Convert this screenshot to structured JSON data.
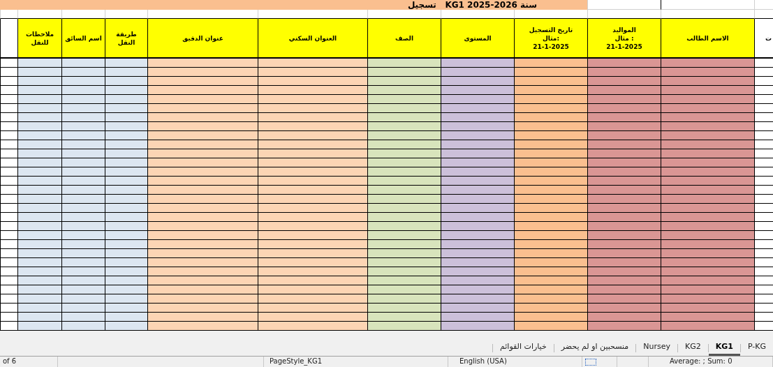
{
  "sheet": {
    "title": "سنة KG1 2025-2026   تسجيل",
    "columns": [
      {
        "header": "ت",
        "color": "#ffffff"
      },
      {
        "header": "الاسم الطالب",
        "color": "#da9694"
      },
      {
        "header": "المواليد\n: مثال\n21-1-2025",
        "color": "#da9694"
      },
      {
        "header": "تاريخ التسجيل\n:مثال\n21-1-2025",
        "color": "#fabf8f"
      },
      {
        "header": "المستوى",
        "color": "#ccc0da"
      },
      {
        "header": "الصف",
        "color": "#d8e4bc"
      },
      {
        "header": "العنوان السكني",
        "color": "#fcd5b4"
      },
      {
        "header": "عنوان الدقيق",
        "color": "#fcd5b4"
      },
      {
        "header": "طريقة النقل",
        "color": "#dce6f1"
      },
      {
        "header": "اسم السائق",
        "color": "#dce6f1"
      },
      {
        "header": "ملاحظات\nللنقل",
        "color": "#dce6f1"
      },
      {
        "color": "#ffffff"
      }
    ]
  },
  "sheet_tabs": [
    {
      "label": "P-KG",
      "selected": false
    },
    {
      "label": "KG1",
      "selected": true
    },
    {
      "label": "KG2",
      "selected": false
    },
    {
      "label": "Nursey",
      "selected": false
    },
    {
      "label": "منسحبين او لم يحضر",
      "selected": false
    },
    {
      "label": "خيارات القوائم",
      "selected": false
    }
  ],
  "status_bar": {
    "page": "of 6",
    "page_style": "PageStyle_KG1",
    "language": "English (USA)",
    "summary": "Average: ; Sum: 0"
  }
}
